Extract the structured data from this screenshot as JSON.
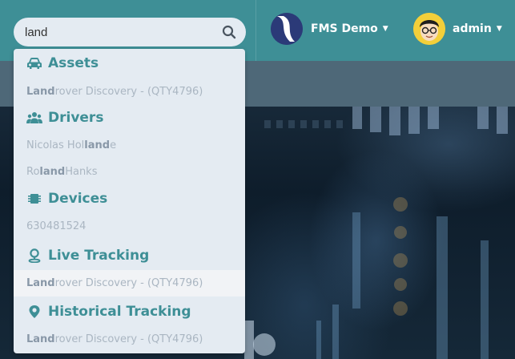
{
  "search": {
    "query": "land"
  },
  "brand": {
    "name": "FMS Demo"
  },
  "user": {
    "name": "admin"
  },
  "colors": {
    "accent": "#3e8f96",
    "nav_bg": "#3e8f96",
    "dropdown_bg": "#e4ebf2",
    "result_text": "#aab6c2",
    "highlight_text": "#8998a8"
  },
  "results": {
    "groups": [
      {
        "label": "Assets",
        "icon": "car-icon",
        "items": [
          {
            "pre": "",
            "match": "Land",
            "post": "rover Discovery - (QTY4796)"
          }
        ]
      },
      {
        "label": "Drivers",
        "icon": "users-icon",
        "items": [
          {
            "pre": "Nicolas Hol",
            "match": "land",
            "post": "e"
          },
          {
            "pre": "Ro",
            "match": "land",
            "post": " Hanks"
          }
        ]
      },
      {
        "label": "Devices",
        "icon": "device-icon",
        "items": [
          {
            "pre": "630481524",
            "match": "",
            "post": ""
          }
        ]
      },
      {
        "label": "Live Tracking",
        "icon": "location-person-icon",
        "items": [
          {
            "pre": "",
            "match": "Land",
            "post": "rover Discovery - (QTY4796)"
          }
        ]
      },
      {
        "label": "Historical Tracking",
        "icon": "map-pin-icon",
        "items": [
          {
            "pre": "",
            "match": "Land",
            "post": "rover Discovery - (QTY4796)"
          }
        ]
      }
    ]
  }
}
